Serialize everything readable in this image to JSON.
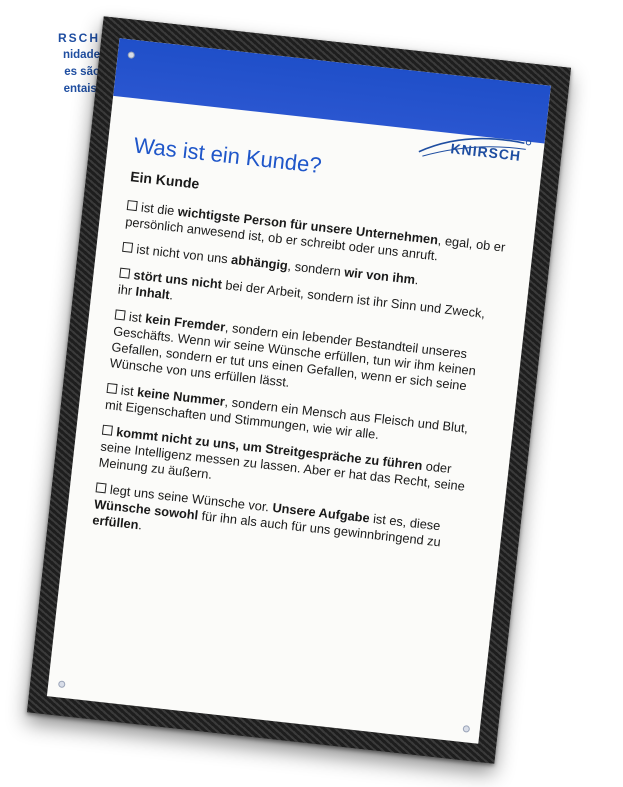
{
  "side_caption": {
    "brand": "RSCH",
    "lines": [
      "nidade",
      "es são",
      "entais."
    ]
  },
  "sign": {
    "logo_text": "KNIRSCH",
    "title": "Was ist ein Kunde?",
    "subtitle": "Ein Kunde",
    "colors": {
      "band": "#1f4fc9",
      "title": "#1f56c9",
      "caption": "#1f4ea1"
    },
    "items": [
      {
        "parts": [
          {
            "text": "ist die ",
            "bold": false
          },
          {
            "text": "wichtigste Person für unsere Unternehmen",
            "bold": true
          },
          {
            "text": ", egal, ob er persönlich anwesend ist, ob er schreibt oder uns anruft.",
            "bold": false
          }
        ]
      },
      {
        "parts": [
          {
            "text": "ist nicht von uns ",
            "bold": false
          },
          {
            "text": "abhängig",
            "bold": true
          },
          {
            "text": ", sondern ",
            "bold": false
          },
          {
            "text": "wir von ihm",
            "bold": true
          },
          {
            "text": ".",
            "bold": false
          }
        ]
      },
      {
        "parts": [
          {
            "text": "stört uns nicht",
            "bold": true
          },
          {
            "text": " bei der Arbeit, sondern ist ihr Sinn und Zweck, ihr ",
            "bold": false
          },
          {
            "text": "Inhalt",
            "bold": true
          },
          {
            "text": ".",
            "bold": false
          }
        ]
      },
      {
        "parts": [
          {
            "text": "ist ",
            "bold": false
          },
          {
            "text": "kein Fremder",
            "bold": true
          },
          {
            "text": ", sondern ein lebender Bestandteil unseres Geschäfts. Wenn wir seine Wünsche erfüllen, tun wir ihm keinen Gefallen, sondern er tut uns einen Gefallen, wenn er sich seine Wünsche von uns erfüllen lässt.",
            "bold": false
          }
        ]
      },
      {
        "parts": [
          {
            "text": "ist ",
            "bold": false
          },
          {
            "text": "keine Nummer",
            "bold": true
          },
          {
            "text": ", sondern ein Mensch aus Fleisch und Blut, mit Eigenschaften und Stimmungen, wie wir alle.",
            "bold": false
          }
        ]
      },
      {
        "parts": [
          {
            "text": "kommt nicht zu uns, um Streitgespräche zu führen",
            "bold": true
          },
          {
            "text": " oder seine Intelligenz messen zu lassen. Aber er hat das Recht, seine Meinung zu äußern.",
            "bold": false
          }
        ]
      },
      {
        "parts": [
          {
            "text": "legt uns seine Wünsche vor. ",
            "bold": false
          },
          {
            "text": "Unsere Aufgabe",
            "bold": true
          },
          {
            "text": " ist es, diese ",
            "bold": false
          },
          {
            "text": "Wünsche sowohl",
            "bold": true
          },
          {
            "text": " für ihn als auch für uns gewinnbringend zu ",
            "bold": false
          },
          {
            "text": "erfüllen",
            "bold": true
          },
          {
            "text": ".",
            "bold": false
          }
        ]
      }
    ]
  }
}
